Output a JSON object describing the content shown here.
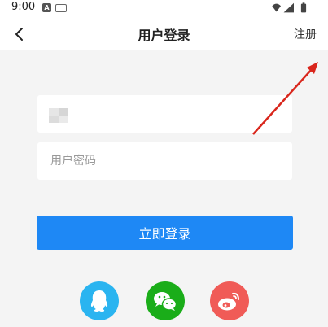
{
  "status_bar": {
    "time": "9:00",
    "icons": [
      "notification-a-icon",
      "keyboard-icon",
      "wifi-icon",
      "signal-icon",
      "battery-icon"
    ]
  },
  "app_bar": {
    "title": "用户登录",
    "register_label": "注册",
    "back_icon": "back-arrow-icon"
  },
  "form": {
    "username_value": "",
    "password_placeholder": "用户密码",
    "login_label": "立即登录"
  },
  "social": [
    {
      "name": "qq",
      "icon": "qq-icon",
      "color": "#2ab4f0"
    },
    {
      "name": "wechat",
      "icon": "wechat-icon",
      "color": "#1aad19"
    },
    {
      "name": "weibo",
      "icon": "weibo-icon",
      "color": "#f05b57"
    }
  ],
  "colors": {
    "accent": "#1e88f5",
    "background": "#f4f4f4",
    "annotation_arrow": "#d9261c"
  }
}
